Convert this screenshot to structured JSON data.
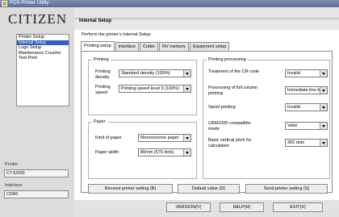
{
  "window": {
    "title": "POS Printer Utility",
    "brand": "CITIZEN"
  },
  "sidebar": {
    "items": [
      {
        "label": "Printer Setup",
        "selected": false
      },
      {
        "label": "Internal Setup",
        "selected": true
      },
      {
        "label": "Logo Setup",
        "selected": false
      },
      {
        "label": "Maintenance Counter",
        "selected": false
      },
      {
        "label": "Test Print",
        "selected": false
      }
    ],
    "printer_label": "Printer",
    "printer_value": "CT-S2000",
    "interface_label": "Interface",
    "interface_value": "COM1"
  },
  "header": {
    "title": "Internal Setup",
    "intro": "Perform the printer's Internal Setup."
  },
  "tabs": [
    {
      "label": "Printing setup",
      "selected": true
    },
    {
      "label": "Interface",
      "selected": false
    },
    {
      "label": "Cutter",
      "selected": false
    },
    {
      "label": "NV memory",
      "selected": false
    },
    {
      "label": "Equipment setup",
      "selected": false
    }
  ],
  "printing": {
    "legend": "Printing",
    "density_label": "Printing density",
    "density_value": "Standard density (100%)",
    "speed_label": "Printing speed",
    "speed_value": "Printing speed level 9 (100%)"
  },
  "paper": {
    "legend": "Paper",
    "kind_label": "Kind of paper",
    "kind_value": "Monochrome paper",
    "width_label": "Paper width",
    "width_value": "80mm (576 dots)"
  },
  "processing": {
    "legend": "Printing processing",
    "cr_label": "Treatment of the CR code",
    "cr_value": "Invalid",
    "full_label": "Processing of full column printing",
    "full_value": "Immediate line feed",
    "spool_label": "Spool printing",
    "spool_value": "Invalid",
    "cbm_label": "CBM1000 compatible mode",
    "cbm_value": "Valid",
    "pitch_label": "Basic vertical pitch for calculation",
    "pitch_value": "360 dots"
  },
  "actions": {
    "receive": "Receive printer setting (B)",
    "default": "Default value (D)",
    "send": "Send printer setting (S)"
  },
  "footer": {
    "version": "VERSION(V)",
    "help": "HELP(H)",
    "exit": "EXIT(X)"
  }
}
